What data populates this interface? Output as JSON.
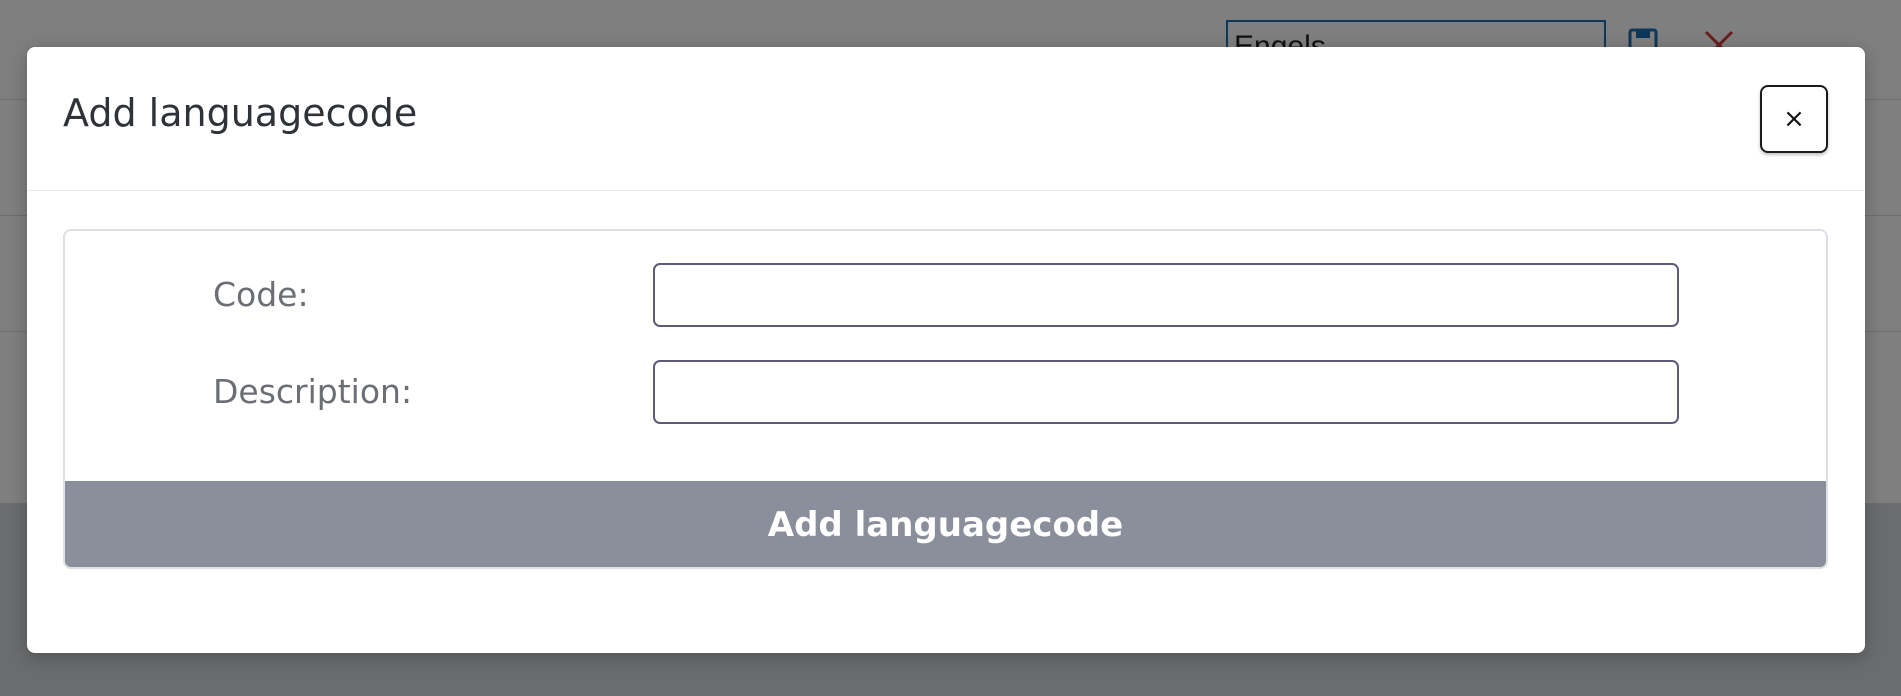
{
  "background": {
    "language_input_value": "Engels",
    "save_icon": "floppy-disk-icon",
    "cancel_icon": "red-x-icon",
    "cancel_color": "#d33a3a",
    "save_color": "#1f6fb3"
  },
  "modal": {
    "title": "Add languagecode",
    "close_label": "×",
    "form": {
      "code_label": "Code:",
      "code_value": "",
      "description_label": "Description:",
      "description_value": "",
      "submit_label": "Add languagecode"
    }
  },
  "colors": {
    "overlay": "rgba(0,0,0,0.5)",
    "submit_button_bg": "#8b8f9c",
    "input_border": "#5f5a7a"
  }
}
